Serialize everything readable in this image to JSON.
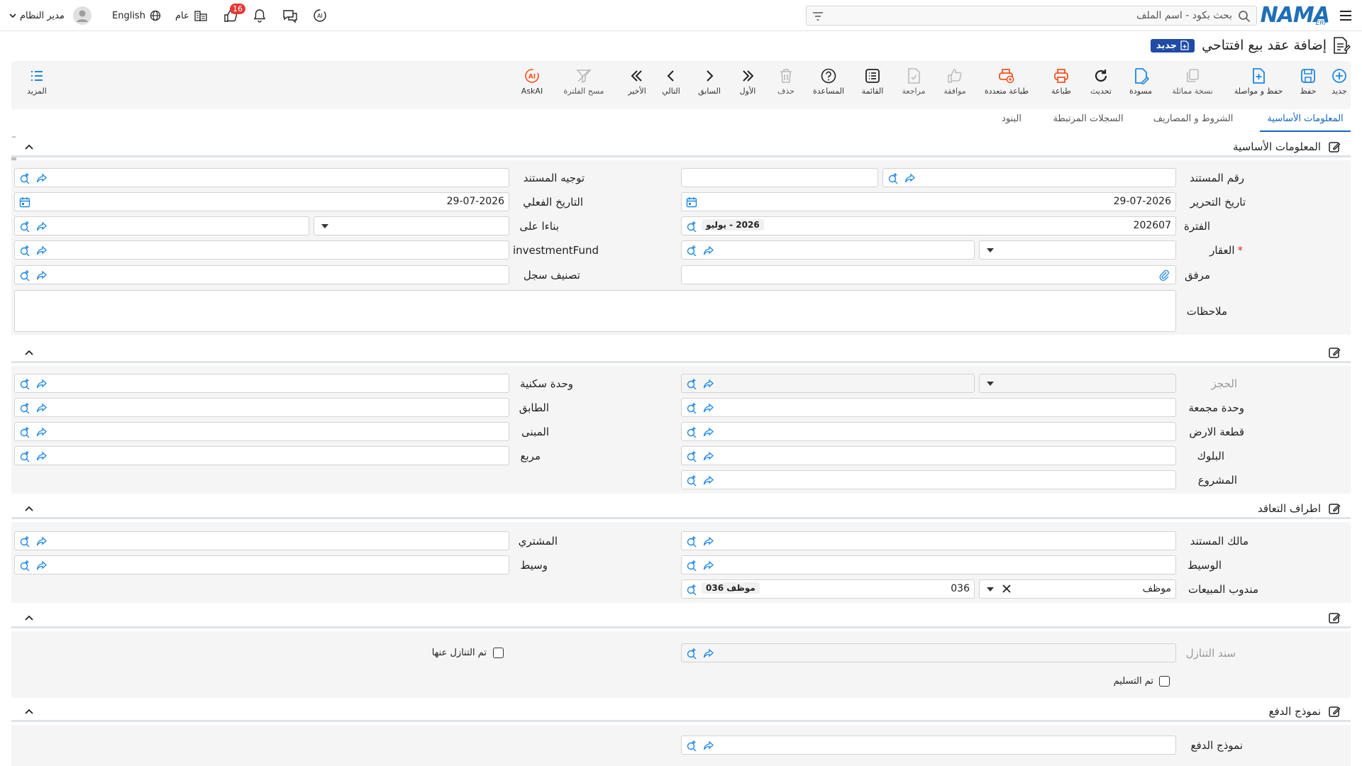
{
  "topbar": {
    "search_placeholder": "بحث بكود - اسم الملف",
    "user_name": "مدير النظام",
    "language": "English",
    "scope": "عام",
    "notification_count": "16",
    "logo_text": "NAMA",
    "logo_sub": "ERP"
  },
  "page": {
    "title": "إضافة عقد بيع افتتاحي",
    "status_badge": "جديد"
  },
  "toolbar": [
    {
      "label": "جديد",
      "icon": "plus-circle-icon"
    },
    {
      "label": "حفظ",
      "icon": "save-icon"
    },
    {
      "label": "حفظ و مواصلة",
      "icon": "save-continue-icon"
    },
    {
      "label": "نسخة مماثلة",
      "icon": "copy-icon"
    },
    {
      "label": "مسودة",
      "icon": "draft-icon"
    },
    {
      "label": "تحديث",
      "icon": "refresh-icon"
    },
    {
      "label": "طباعة",
      "icon": "print-icon"
    },
    {
      "label": "طباعة متعددة",
      "icon": "multi-print-icon"
    },
    {
      "label": "موافقة",
      "icon": "thumbs-up-icon"
    },
    {
      "label": "مراجعة",
      "icon": "review-icon"
    },
    {
      "label": "القائمة",
      "icon": "list-icon"
    },
    {
      "label": "المساعدة",
      "icon": "help-icon"
    },
    {
      "label": "حذف",
      "icon": "trash-icon"
    },
    {
      "label": "الأول",
      "icon": "first-icon"
    },
    {
      "label": "السابق",
      "icon": "previous-icon"
    },
    {
      "label": "التالي",
      "icon": "next-icon"
    },
    {
      "label": "الأخير",
      "icon": "last-icon"
    },
    {
      "label": "مسح الفلترة",
      "icon": "clear-filter-icon"
    },
    {
      "label": "AskAI",
      "icon": "ask-ai-icon"
    }
  ],
  "toolbar_more": "المزيد",
  "tabs": [
    "المعلومات الأساسية",
    "الشروط و المصاريف",
    "السجلات المرتبطة",
    "البنود"
  ],
  "sections": {
    "basic": "المعلومات الأساسية",
    "parties": "اطراف التعاقد",
    "payment": "نموذج الدفع"
  },
  "fields": {
    "doc_number": "رقم المستند",
    "doc_direction": "توجيه المستند",
    "issue_date": "تاريخ التحرير",
    "issue_date_value": "29-07-2026",
    "actual_date": "التاريخ الفعلي",
    "actual_date_value": "29-07-2026",
    "period": "الفترة",
    "period_code": "202607",
    "period_name": "2026 - يوليو",
    "based_on": "بناءا على",
    "property": "العقار",
    "investment_fund": "investmentFund",
    "attachment": "مرفق",
    "record_class": "تصنيف سجل",
    "notes": "ملاحظات",
    "reservation": "الحجز",
    "residential_unit": "وحدة سكنية",
    "aggregate_unit": "وحدة مجمعة",
    "floor": "الطابق",
    "land_plot": "قطعة الارض",
    "building": "المبنى",
    "block": "البلوك",
    "square": "مربع",
    "project": "المشروع",
    "doc_owner": "مالك المستند",
    "buyer": "المشتري",
    "broker": "الوسيط",
    "intermediary": "وسيط",
    "sales_rep": "مندوب المبيعات",
    "sales_rep_type": "موظف",
    "sales_rep_code": "036",
    "sales_rep_chip": "موظف 036",
    "waiver_doc": "سند التنازل",
    "waived": "تم التنازل عنها",
    "delivered": "تم التسليم",
    "payment_model": "نموذج الدفع"
  }
}
